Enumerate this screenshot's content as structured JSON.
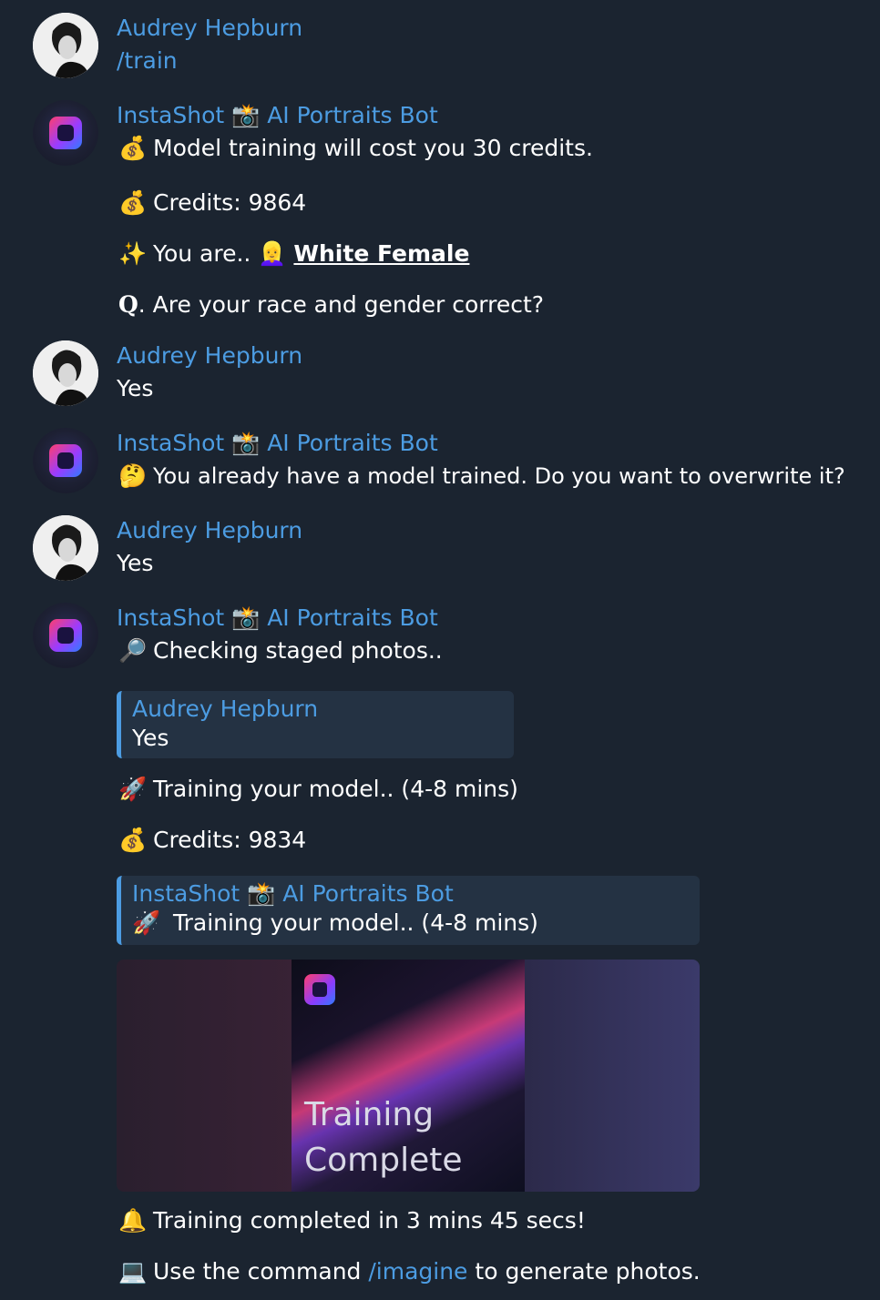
{
  "messages": {
    "m1": {
      "sender": "Audrey Hepburn",
      "text": "/train"
    },
    "m2": {
      "sender": "InstaShot 📸 AI Portraits Bot",
      "line1_emoji": "💰",
      "line1": "Model training will cost you 30 credits.",
      "line2_emoji": "💰",
      "line2": "Credits: 9864",
      "line3_emoji": "✨",
      "line3_prefix": "You are..",
      "line3_emoji2": "👱‍♀️",
      "line3_link": "White Female",
      "line4_prefix": "Q",
      "line4": ". Are your race and gender correct?"
    },
    "m3": {
      "sender": "Audrey Hepburn",
      "text": "Yes"
    },
    "m4": {
      "sender": "InstaShot 📸 AI Portraits Bot",
      "emoji": "🤔",
      "text": "You already have a model trained. Do you want to overwrite it?"
    },
    "m5": {
      "sender": "Audrey Hepburn",
      "text": "Yes"
    },
    "m6": {
      "sender": "InstaShot 📸 AI Portraits Bot",
      "line1_emoji": "🔎",
      "line1": "Checking staged photos..",
      "quote1_name": "Audrey Hepburn",
      "quote1_text": "Yes",
      "line2_emoji": "🚀",
      "line2": "Training your model.. (4-8 mins)",
      "line3_emoji": "💰",
      "line3": "Credits: 9834",
      "quote2_name": "InstaShot 📸 AI Portraits Bot",
      "quote2_emoji": "🚀",
      "quote2_text": "Training your model.. (4-8 mins)",
      "media_line1": "Training",
      "media_line2": "Complete",
      "line4_emoji": "🔔",
      "line4": "Training completed in 3 mins 45 secs!",
      "line5_emoji": "💻",
      "line5_prefix": "Use the command",
      "line5_cmd": "/imagine",
      "line5_suffix": "to generate photos."
    }
  },
  "colors": {
    "background": "#1b2430",
    "accent": "#4c9ce2",
    "text": "#ffffff"
  }
}
